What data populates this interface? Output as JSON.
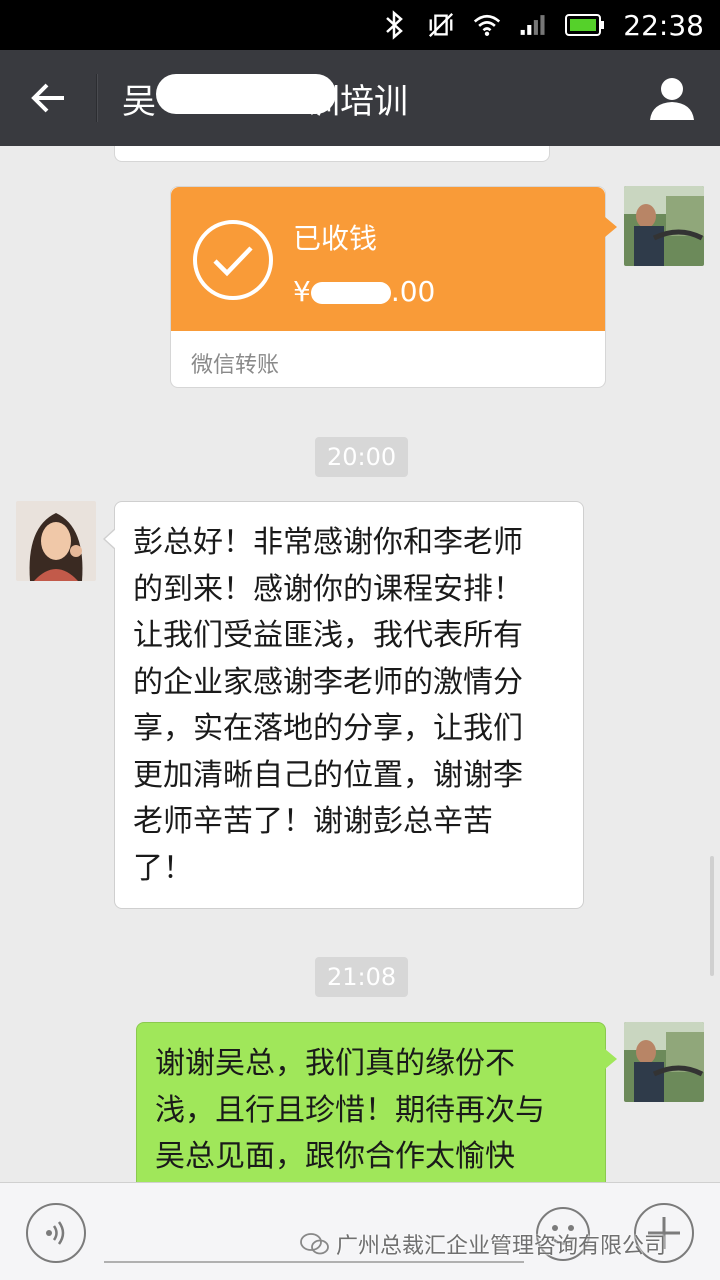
{
  "status_bar": {
    "time": "22:38",
    "icons": [
      "bluetooth-icon",
      "vibrate-off-icon",
      "wifi-icon",
      "signal-icon",
      "battery-icon"
    ]
  },
  "header": {
    "title": "吴",
    "title_suffix": "训培训",
    "back_icon": "back-arrow-icon",
    "profile_icon": "person-icon"
  },
  "messages": {
    "transfer": {
      "status": "已收钱",
      "amount_prefix": "¥",
      "amount_suffix": ".00",
      "footer": "微信转账"
    },
    "timestamp_1": "20:00",
    "incoming": {
      "lines": [
        "彭总好！非常感谢你和李老师",
        "的到来！感谢你的课程安排！",
        "让我们受益匪浅，我代表所有",
        "的企业家感谢李老师的激情分",
        "享，实在落地的分享，让我们",
        "更加清晰自己的位置，谢谢李",
        "老师辛苦了！谢谢彭总辛苦",
        "了！"
      ]
    },
    "timestamp_2": "21:08",
    "outgoing": {
      "lines": [
        "谢谢吴总，我们真的缘份不",
        "浅，且行且珍惜！期待再次与",
        "吴总见面，跟你合作太愉快"
      ]
    }
  },
  "input_bar": {
    "voice_icon": "voice-icon",
    "emoji_icon": "emoji-icon",
    "plus_icon": "plus-icon"
  },
  "watermark": {
    "text": "广州总裁汇企业管理咨询有限公司"
  },
  "colors": {
    "title_bar": "#393a3f",
    "transfer_orange": "#f99b38",
    "outgoing_green": "#a0e75a",
    "chat_bg": "#ebebeb"
  }
}
